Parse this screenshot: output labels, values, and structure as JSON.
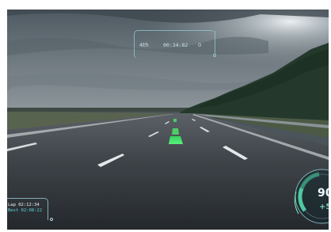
{
  "hud": {
    "position": "4th",
    "race_time": "00:34:82",
    "marker": "0",
    "lap_time": "Lap 02:12:34",
    "best_time": "Best 02:08:22",
    "speed": "90",
    "gear": "+5"
  },
  "colors": {
    "hud_line": "#96cdd7",
    "hud_text": "#d2f0f5",
    "accent": "#5fd3e0",
    "racing_line": "#4fe26a",
    "tach_fill": "#4fcaa0"
  }
}
